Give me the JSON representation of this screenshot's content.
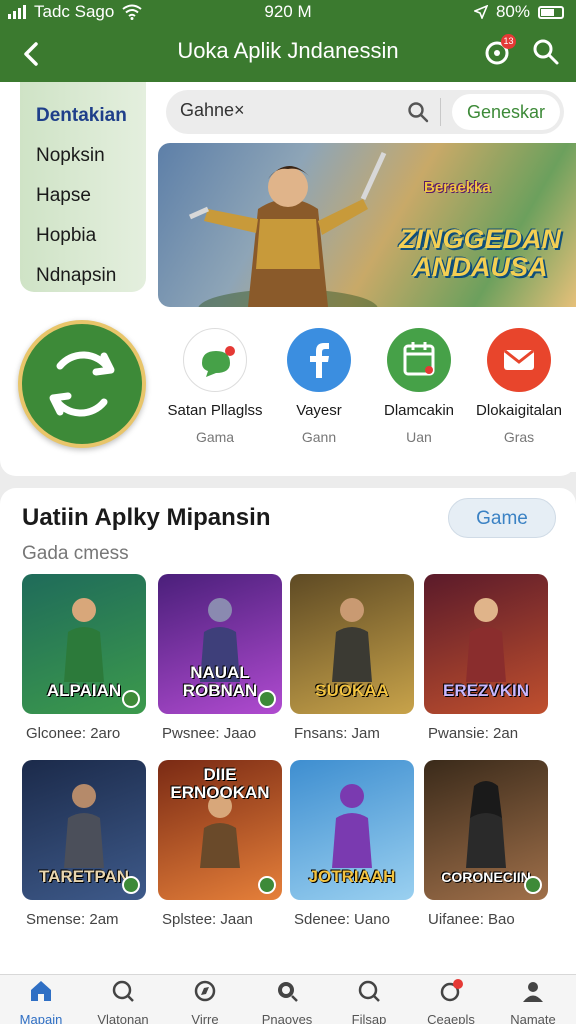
{
  "status_bar": {
    "carrier": "Tadc Sago",
    "time": "920 M",
    "battery": "80%"
  },
  "app_bar": {
    "title": "Uoka Aplik Jndanessin",
    "notif_badge": "13"
  },
  "sidebar": {
    "items": [
      {
        "label": "Dentakian",
        "active": true
      },
      {
        "label": "Nopksin"
      },
      {
        "label": "Hapse"
      },
      {
        "label": "Hopbia"
      },
      {
        "label": "Ndnapsin"
      }
    ]
  },
  "search": {
    "query": "Gahne",
    "clear": "×",
    "button": "Geneskar"
  },
  "banner": {
    "small_title": "Beraekka",
    "big_title": "ZINGGEDAN ANDAUSA"
  },
  "apps": [
    {
      "name": "Satan Pllaglss",
      "sub": "Gama",
      "icon": "chat-bubble-icon",
      "color": "#ffffff"
    },
    {
      "name": "Vayesr",
      "sub": "Gann",
      "icon": "facebook-icon",
      "color": "#3b8ee0"
    },
    {
      "name": "Dlamcakin",
      "sub": "Uan",
      "icon": "calendar-icon",
      "color": "#46a148"
    },
    {
      "name": "Dlokaigitalan",
      "sub": "Gras",
      "icon": "mail-icon",
      "color": "#e8452c"
    }
  ],
  "section": {
    "title": "Uatiin Aplky Mipansin",
    "subtitle": "Gada cmess",
    "button": "Game"
  },
  "games_row1": [
    {
      "title": "ALPAIAN",
      "caption": "Glconee: 2aro",
      "bg1": "#1f6b5a",
      "bg2": "#3c9a4c",
      "fig": "#2c7a3a"
    },
    {
      "title": "NAUAL ROBNAN",
      "caption": "Pwsnee: Jaao",
      "bg1": "#4a1f7a",
      "bg2": "#b04bd0",
      "fig": "#3e3f7a"
    },
    {
      "title": "SUOKAA",
      "caption": "Fnsans: Jam",
      "bg1": "#5e4a24",
      "bg2": "#c8a34a",
      "fig": "#3b3a33"
    },
    {
      "title": "EREZVKIN",
      "caption": "Pwansie: 2an",
      "bg1": "#5a1a2a",
      "bg2": "#c0502e",
      "fig": "#8a2d2d"
    }
  ],
  "games_row2": [
    {
      "title": "TARETPAN",
      "caption": "Smense: 2am",
      "bg1": "#1b2a4a",
      "bg2": "#3e5a8a",
      "fig": "#4b4f5a"
    },
    {
      "title": "DIIE ERNOOKAN",
      "caption": "Splstee: Jaan",
      "bg1": "#7a2a14",
      "bg2": "#e6803a",
      "fig": "#6a4a2a"
    },
    {
      "title": "JOTRIAAH",
      "caption": "Sdenee: Uano",
      "bg1": "#3e8ed0",
      "bg2": "#9ad0f0",
      "fig": "#7a3ab0"
    },
    {
      "title": "CORONECIIN",
      "caption": "Uifanee: Bao",
      "bg1": "#3a2a1a",
      "bg2": "#a0704a",
      "fig": "#2a2a2a"
    }
  ],
  "bottom_nav": [
    {
      "label": "Mapain",
      "icon": "home-icon",
      "active": true
    },
    {
      "label": "Vlatonan",
      "icon": "explore-icon"
    },
    {
      "label": "Virre",
      "icon": "compass-icon"
    },
    {
      "label": "Pnaoves",
      "icon": "search-icon"
    },
    {
      "label": "Filsap",
      "icon": "search-alt-icon"
    },
    {
      "label": "Ceaepls",
      "icon": "notification-icon",
      "badge": "13"
    },
    {
      "label": "Namate",
      "icon": "profile-icon"
    }
  ]
}
